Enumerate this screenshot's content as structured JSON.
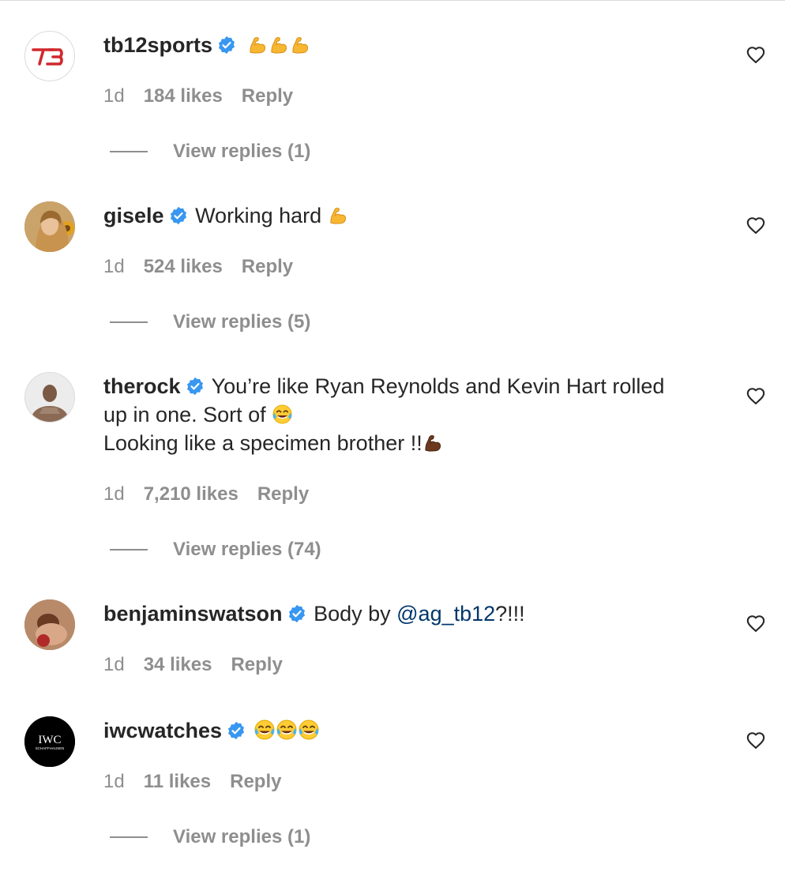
{
  "comments": [
    {
      "username": "tb12sports",
      "text": "",
      "emoji": "flexed-biceps x3",
      "time": "1d",
      "likes": "184 likes",
      "reply": "Reply",
      "view_replies": "View replies (1)"
    },
    {
      "username": "gisele",
      "text": "Working hard",
      "emoji": "flexed-biceps",
      "time": "1d",
      "likes": "524 likes",
      "reply": "Reply",
      "view_replies": "View replies (5)"
    },
    {
      "username": "therock",
      "text_line1": "You’re like Ryan Reynolds and Kevin Hart rolled",
      "text_line2": "up in one. Sort of",
      "text_line3": "Looking like a specimen brother !!",
      "emoji": "tears-of-joy, flexed-biceps-dark",
      "time": "1d",
      "likes": "7,210 likes",
      "reply": "Reply",
      "view_replies": "View replies (74)"
    },
    {
      "username": "benjaminswatson",
      "text": "Body by",
      "mention": "@ag_tb12",
      "text_after": "?!!!",
      "time": "1d",
      "likes": "34 likes",
      "reply": "Reply"
    },
    {
      "username": "iwcwatches",
      "text": "",
      "emoji": "tears-of-joy x3",
      "time": "1d",
      "likes": "11 likes",
      "reply": "Reply",
      "view_replies": "View replies (1)"
    }
  ],
  "avatars": {
    "tb12sports_logo": "TB",
    "iwc_logo": "IWC",
    "iwc_sub": "SCHAFFHAUSEN"
  },
  "colors": {
    "text": "#262626",
    "secondary": "#8e8e8e",
    "verified": "#3897f0",
    "mention": "#00376b",
    "tb12_red": "#d0282e"
  },
  "icons": [
    "verified-badge-icon",
    "heart-icon",
    "flexed-biceps-emoji",
    "tears-of-joy-emoji"
  ]
}
